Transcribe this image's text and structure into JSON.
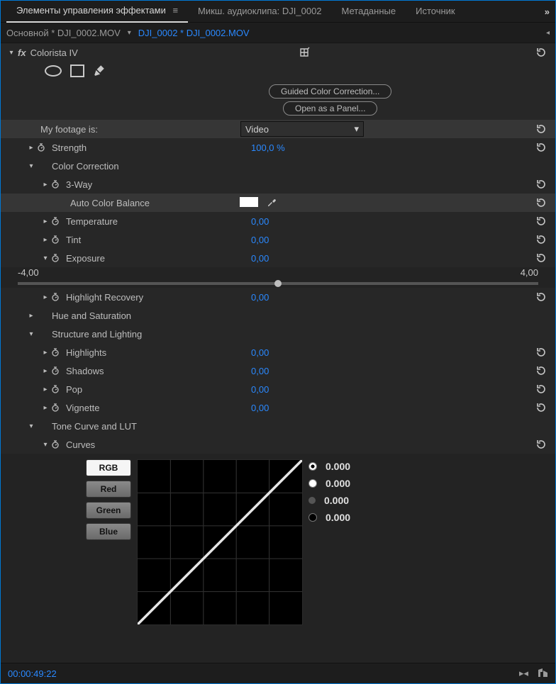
{
  "tabs": {
    "t0": "Элементы управления эффектами",
    "t1": "Микш. аудиоклипа: DJI_0002",
    "t2": "Метаданные",
    "t3": "Источник",
    "overflow": "»"
  },
  "crumb": {
    "left": "Основной * DJI_0002.MOV",
    "right": "DJI_0002 * DJI_0002.MOV"
  },
  "effect": {
    "name": "Colorista IV",
    "guided": "Guided Color Correction...",
    "open_panel": "Open as a Panel...",
    "footage_label": "My footage is:",
    "footage_value": "Video",
    "strength_label": "Strength",
    "strength_value": "100,0 %",
    "color_correction_label": "Color Correction",
    "three_way_label": "3-Way",
    "auto_color_label": "Auto Color Balance",
    "temperature_label": "Temperature",
    "temperature_value": "0,00",
    "tint_label": "Tint",
    "tint_value": "0,00",
    "exposure_label": "Exposure",
    "exposure_value": "0,00",
    "exposure_min": "-4,00",
    "exposure_max": "4,00",
    "highlight_recovery_label": "Highlight Recovery",
    "highlight_recovery_value": "0,00",
    "hue_sat_label": "Hue and Saturation",
    "structure_label": "Structure and Lighting",
    "highlights_label": "Highlights",
    "highlights_value": "0,00",
    "shadows_label": "Shadows",
    "shadows_value": "0,00",
    "pop_label": "Pop",
    "pop_value": "0,00",
    "vignette_label": "Vignette",
    "vignette_value": "0,00",
    "tonecurve_label": "Tone Curve and LUT",
    "curves_label": "Curves"
  },
  "curves": {
    "channels": {
      "rgb": "RGB",
      "red": "Red",
      "green": "Green",
      "blue": "Blue"
    },
    "readouts": {
      "r0": "0.000",
      "r1": "0.000",
      "r2": "0.000",
      "r3": "0.000"
    }
  },
  "timecode": "00:00:49:22"
}
